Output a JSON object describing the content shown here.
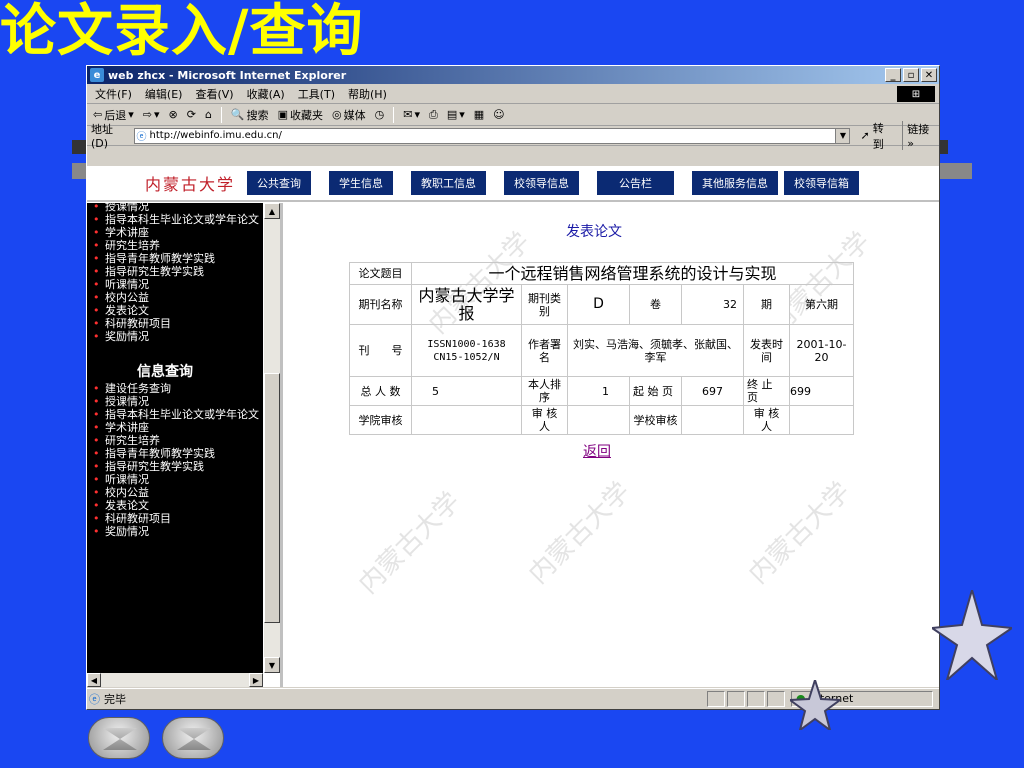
{
  "slide_title": "论文录入/查询",
  "browser": {
    "window_title": "web zhcx - Microsoft Internet Explorer",
    "menus": [
      "文件(F)",
      "编辑(E)",
      "查看(V)",
      "收藏(A)",
      "工具(T)",
      "帮助(H)"
    ],
    "toolbar": {
      "back": "后退",
      "search": "搜索",
      "favorites": "收藏夹",
      "media": "媒体"
    },
    "address_label": "地址(D)",
    "address_value": "http://webinfo.imu.edu.cn/",
    "go_label": "转到",
    "links_label": "链接 »",
    "status_text": "完毕",
    "zone_text": "Internet"
  },
  "site": {
    "brand": "内蒙古大学",
    "nav": [
      "公共查询",
      "学生信息",
      "教职工信息",
      "校领导信息",
      "公告栏",
      "其他服务信息",
      "校领导信箱"
    ]
  },
  "sidebar": {
    "top_items": [
      "授课情况",
      "指导本科生毕业论文或学年论文",
      "学术讲座",
      "研究生培养",
      "指导青年教师教学实践",
      "指导研究生教学实践",
      "听课情况",
      "校内公益",
      "发表论文",
      "科研教研项目",
      "奖励情况"
    ],
    "section_title": "信息查询",
    "items": [
      "建设任务查询",
      "授课情况",
      "指导本科生毕业论文或学年论文",
      "学术讲座",
      "研究生培养",
      "指导青年教师教学实践",
      "指导研究生教学实践",
      "听课情况",
      "校内公益",
      "发表论文",
      "科研教研项目",
      "奖励情况"
    ]
  },
  "content": {
    "heading": "发表论文",
    "watermark": "内蒙古大学",
    "labels": {
      "title": "论文题目",
      "journal": "期刊名称",
      "journal_type": "期刊类别",
      "volume": "卷",
      "issue": "期",
      "issn": "刊　　号",
      "authors": "作者署名",
      "pub_date": "发表时间",
      "total": "总 人 数",
      "rank": "本人排序",
      "start_page": "起 始 页",
      "end_page": "终 止 页",
      "college_review": "学院审核",
      "reviewer1": "审 核 人",
      "school_review": "学校审核",
      "reviewer2": "审 核 人"
    },
    "values": {
      "title": "一个远程销售网络管理系统的设计与实现",
      "journal": "内蒙古大学学报",
      "journal_type": "D",
      "volume": "32",
      "issue": "第六期",
      "issn": "ISSN1000-1638 CN15-1052/N",
      "authors": "刘实、马浩海、须毓孝、张献国、李军",
      "pub_date": "2001-10-20",
      "total": "5",
      "rank": "1",
      "start_page": "697",
      "end_page": "699"
    },
    "back_link": "返回"
  }
}
